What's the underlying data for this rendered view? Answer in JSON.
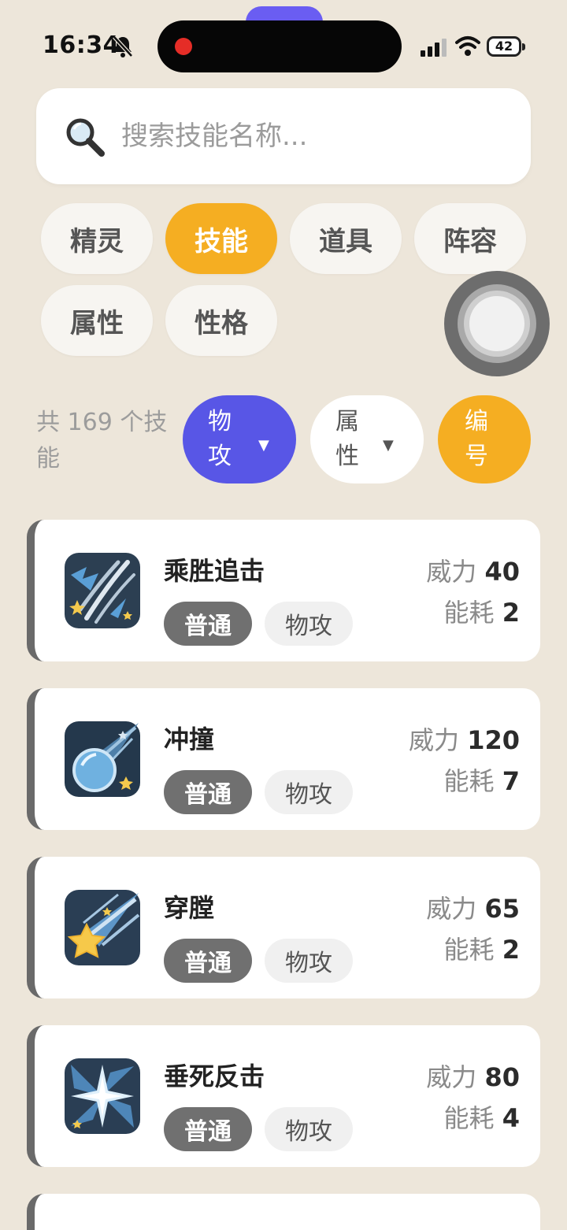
{
  "status_bar": {
    "time": "16:34",
    "battery": "42",
    "mute_icon": "bell-slash-icon"
  },
  "search": {
    "placeholder": "搜索技能名称...",
    "value": "",
    "icon": "magnifier-icon"
  },
  "categories": [
    {
      "label": "精灵",
      "active": false
    },
    {
      "label": "技能",
      "active": true
    },
    {
      "label": "道具",
      "active": false
    },
    {
      "label": "阵容",
      "active": false
    },
    {
      "label": "属性",
      "active": false
    },
    {
      "label": "性格",
      "active": false
    }
  ],
  "filters": {
    "count_text": "共 169 个技能",
    "type": {
      "label": "物攻",
      "caret": "▼"
    },
    "attribute": {
      "label": "属性",
      "caret": "▼"
    },
    "sort": {
      "label": "编号"
    }
  },
  "skills": [
    {
      "name": "乘胜追击",
      "element": "普通",
      "category": "物攻",
      "power_label": "威力",
      "power": "40",
      "cost_label": "能耗",
      "cost": "2",
      "icon": "claw-slash-icon"
    },
    {
      "name": "冲撞",
      "element": "普通",
      "category": "物攻",
      "power_label": "威力",
      "power": "120",
      "cost_label": "能耗",
      "cost": "7",
      "icon": "comet-icon"
    },
    {
      "name": "穿膛",
      "element": "普通",
      "category": "物攻",
      "power_label": "威力",
      "power": "65",
      "cost_label": "能耗",
      "cost": "2",
      "icon": "shooting-star-icon"
    },
    {
      "name": "垂死反击",
      "element": "普通",
      "category": "物攻",
      "power_label": "威力",
      "power": "80",
      "cost_label": "能耗",
      "cost": "4",
      "icon": "burst-star-icon"
    }
  ],
  "colors": {
    "background": "#ede6da",
    "accent_orange": "#f5ae22",
    "accent_purple": "#5856e6",
    "element_normal": "#707070"
  }
}
